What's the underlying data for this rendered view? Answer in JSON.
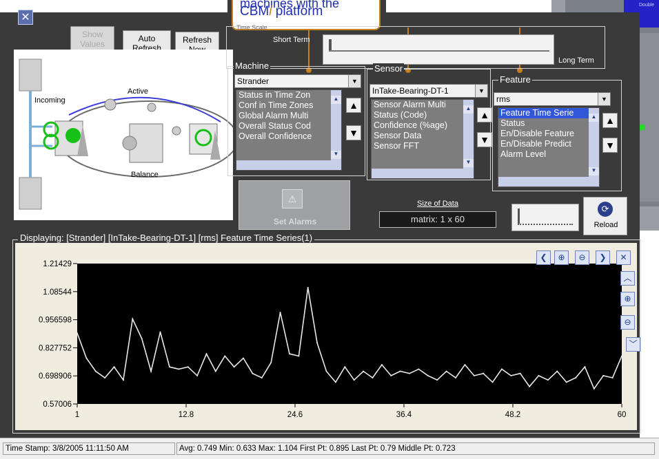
{
  "window": {
    "close_glyph": "✕",
    "buttons": {
      "show_values": "Show Values",
      "auto_refresh": "Auto Refresh",
      "refresh_now": "Refresh Now"
    }
  },
  "callout": {
    "line1": "machines with the",
    "line2_prefix": "CBM",
    "line2_i": "i",
    "line2_suffix": " platform",
    "border_color": "#c8811e"
  },
  "diagram": {
    "labels": {
      "incoming": "Incoming",
      "active": "Active",
      "balance": "Balance"
    }
  },
  "time_scale": {
    "label": "Short Term",
    "right_label": "Long Term",
    "faint_label": "Time Scale"
  },
  "machine": {
    "title": "Machine",
    "selected": "Strander",
    "items": [
      "Status in Time Zon",
      "Conf in Time Zones",
      "Global Alarm Multi",
      "Overall Status Cod",
      "Overall Confidence"
    ]
  },
  "sensor": {
    "title": "Sensor",
    "selected": "InTake-Bearing-DT-1",
    "items": [
      "Sensor Alarm Multi",
      "Status (Code)",
      "Confidence (%age)",
      "Sensor Data",
      "Sensor FFT"
    ]
  },
  "feature": {
    "title": "Feature",
    "selected": "rms",
    "items": [
      "Feature Time Serie",
      "Status",
      "En/Disable Feature",
      "En/Disable Predict",
      "Alarm Level"
    ],
    "highlighted_index": 0
  },
  "actions": {
    "set_alarms": "Set Alarms",
    "size_of_data_label": "Size of Data",
    "size_of_data_value": "matrix:  1  x  60",
    "reload": "Reload"
  },
  "plot": {
    "title": "Displaying: [Strander] [InTake-Bearing-DT-1] [rms] Feature Time Series(1)"
  },
  "chart_data": {
    "type": "line",
    "xlim": [
      1,
      60
    ],
    "ylim": [
      0.57006,
      1.21429
    ],
    "x_ticks": [
      "1",
      "12.8",
      "24.6",
      "36.4",
      "48.2",
      "60"
    ],
    "y_ticks": [
      "1.21429",
      "1.08544",
      "0.956598",
      "0.827752",
      "0.698906",
      "0.57006"
    ],
    "x": [
      1,
      2,
      3,
      4,
      5,
      6,
      7,
      8,
      9,
      10,
      11,
      12,
      13,
      14,
      15,
      16,
      17,
      18,
      19,
      20,
      21,
      22,
      23,
      24,
      25,
      26,
      27,
      28,
      29,
      30,
      31,
      32,
      33,
      34,
      35,
      36,
      37,
      38,
      39,
      40,
      41,
      42,
      43,
      44,
      45,
      46,
      47,
      48,
      49,
      50,
      51,
      52,
      53,
      54,
      55,
      56,
      57,
      58,
      59,
      60
    ],
    "values": [
      0.895,
      0.78,
      0.72,
      0.69,
      0.74,
      0.68,
      0.96,
      0.87,
      0.72,
      0.9,
      0.74,
      0.73,
      0.74,
      0.7,
      0.8,
      0.72,
      0.79,
      0.74,
      0.78,
      0.71,
      0.69,
      0.76,
      0.99,
      0.8,
      0.79,
      1.104,
      0.85,
      0.72,
      0.67,
      0.74,
      0.68,
      0.72,
      0.69,
      0.75,
      0.7,
      0.72,
      0.71,
      0.73,
      0.7,
      0.68,
      0.72,
      0.69,
      0.75,
      0.7,
      0.71,
      0.67,
      0.73,
      0.7,
      0.71,
      0.65,
      0.7,
      0.68,
      0.72,
      0.67,
      0.69,
      0.74,
      0.64,
      0.7,
      0.69,
      0.79
    ],
    "line_color": "#e8e8e8",
    "plot_bg": "#000000"
  },
  "status_bar": {
    "timestamp": "Time Stamp: 3/8/2005 11:11:50 AM",
    "summary": "Avg: 0.749 Min: 0.633 Max: 1.104 First Pt: 0.895 Last Pt: 0.79 Middle Pt: 0.723"
  },
  "background_window": {
    "label": "Double"
  }
}
